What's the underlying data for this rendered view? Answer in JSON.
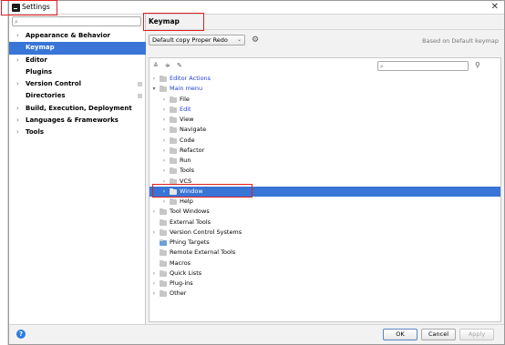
{
  "window": {
    "title": "Settings",
    "close": "✕"
  },
  "left": {
    "search_placeholder": "",
    "items": [
      {
        "label": "Appearance & Behavior",
        "arrow": "›"
      },
      {
        "label": "Keymap",
        "arrow": "",
        "selected": true
      },
      {
        "label": "Editor",
        "arrow": "›"
      },
      {
        "label": "Plugins",
        "arrow": ""
      },
      {
        "label": "Version Control",
        "arrow": "›"
      },
      {
        "label": "Directories",
        "arrow": ""
      },
      {
        "label": "Build, Execution, Deployment",
        "arrow": "›"
      },
      {
        "label": "Languages & Frameworks",
        "arrow": "›"
      },
      {
        "label": "Tools",
        "arrow": "›"
      }
    ]
  },
  "right": {
    "title": "Keymap",
    "scheme_value": "Default copy Proper Redo",
    "based_on": "Based on Default keymap",
    "tree": [
      {
        "label": "Editor Actions",
        "blue": true
      },
      {
        "label": "Main menu",
        "blue": true
      },
      {
        "label": "File"
      },
      {
        "label": "Edit",
        "blue": true
      },
      {
        "label": "View"
      },
      {
        "label": "Navigate"
      },
      {
        "label": "Code"
      },
      {
        "label": "Refactor"
      },
      {
        "label": "Run"
      },
      {
        "label": "Tools"
      },
      {
        "label": "VCS"
      },
      {
        "label": "Window",
        "selected": true
      },
      {
        "label": "Help"
      },
      {
        "label": "Tool Windows"
      },
      {
        "label": "External Tools"
      },
      {
        "label": "Version Control Systems"
      },
      {
        "label": "Phing Targets"
      },
      {
        "label": "Remote External Tools"
      },
      {
        "label": "Macros"
      },
      {
        "label": "Quick Lists"
      },
      {
        "label": "Plug-ins"
      },
      {
        "label": "Other"
      }
    ]
  },
  "buttons": {
    "help": "?",
    "ok": "OK",
    "cancel": "Cancel",
    "apply": "Apply"
  },
  "colors": {
    "selection": "#3875d7",
    "highlight_box": "#e0201f",
    "link_blue": "#1f3fd1"
  }
}
